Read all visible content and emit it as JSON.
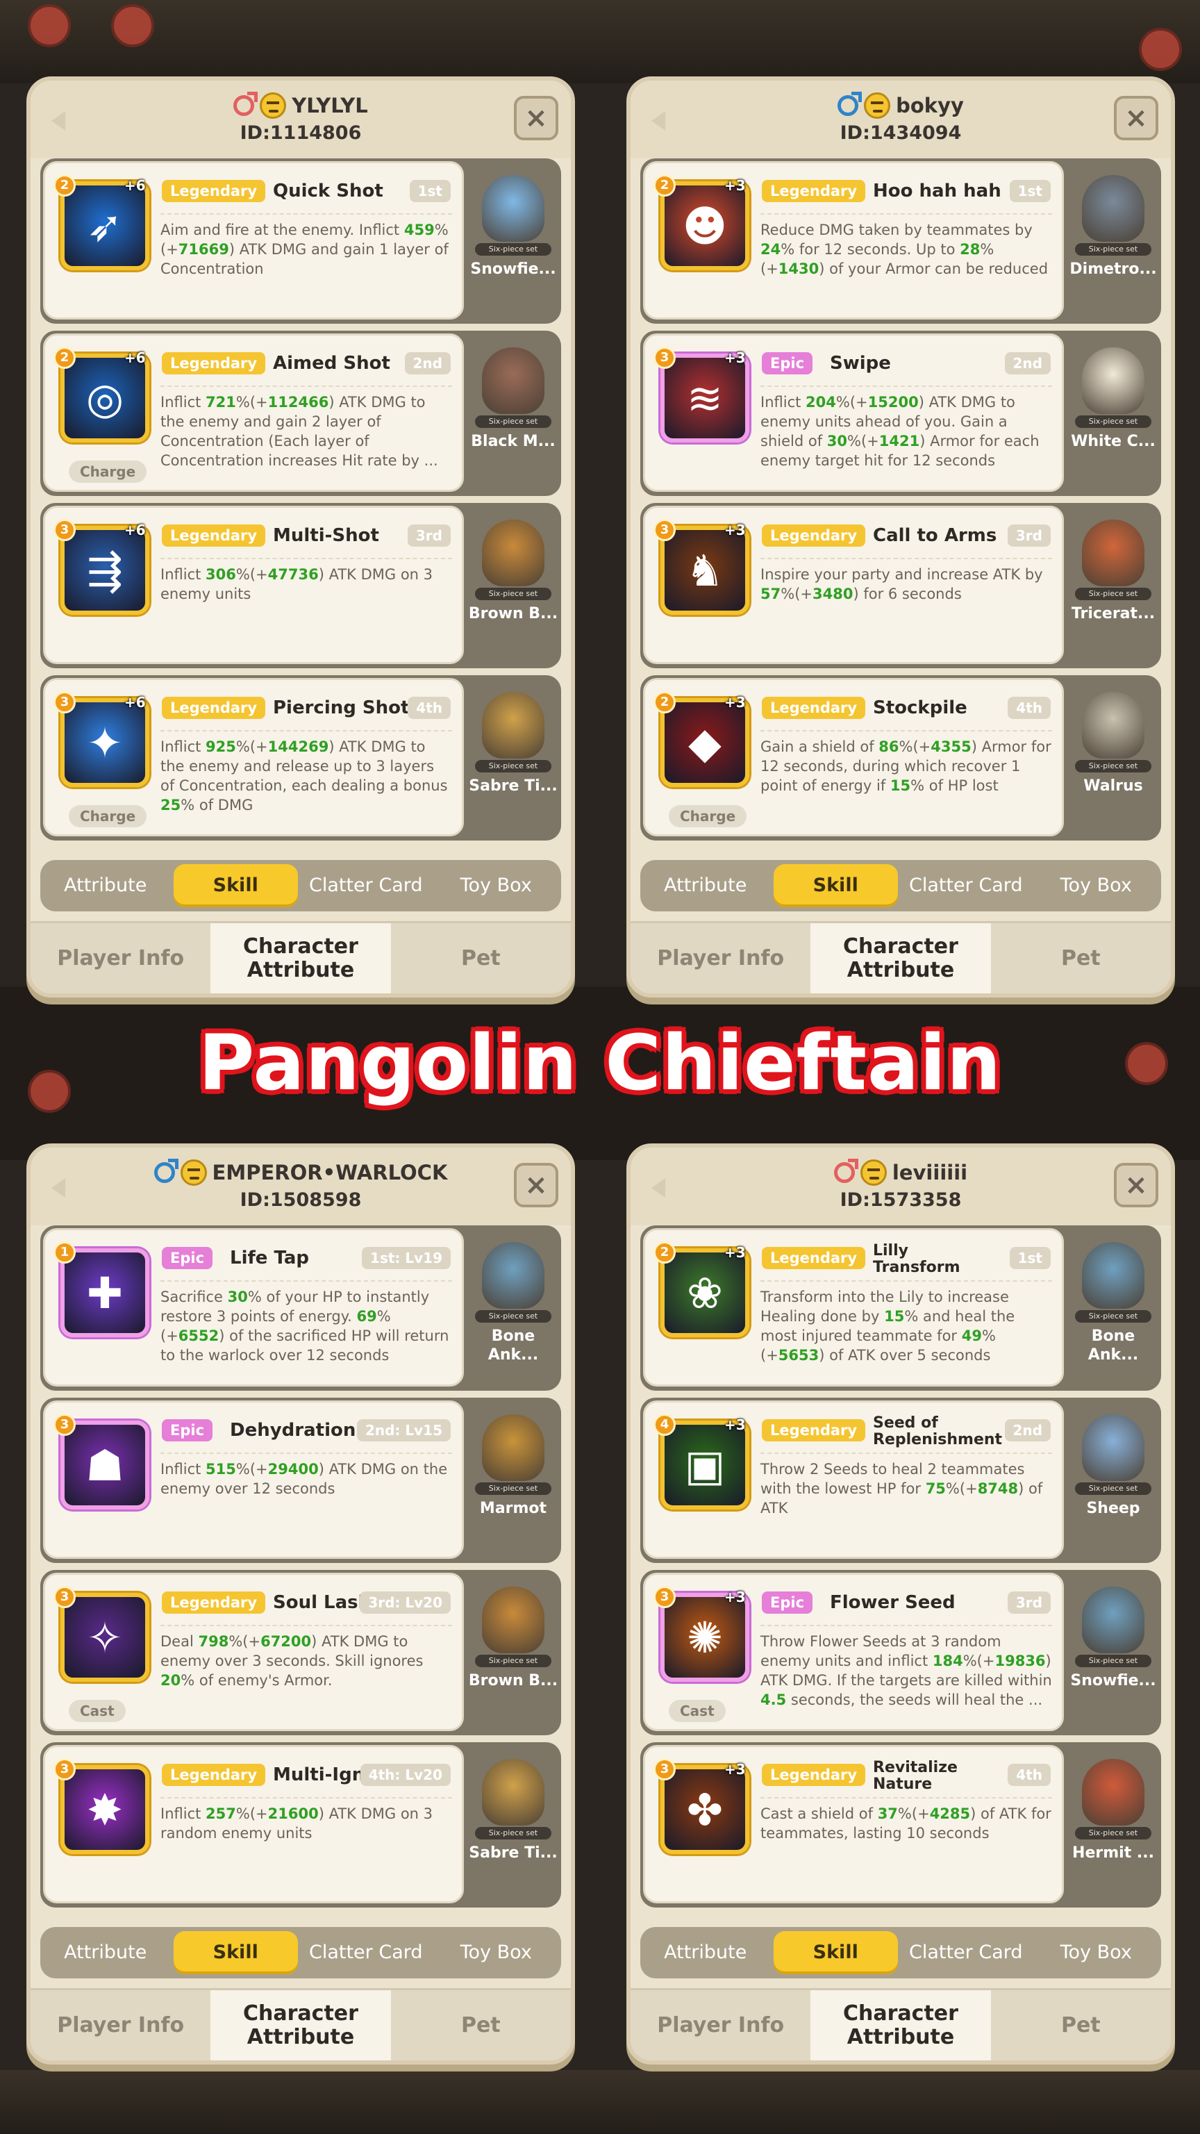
{
  "title": "Pangolin Chieftain",
  "panels": [
    {
      "gender": "female",
      "name": "YLYLYL",
      "id": "ID:1114806",
      "close_label": "×",
      "skills": [
        {
          "rarity": "Legendary",
          "name": "Quick Shot",
          "order": "1st",
          "stars": "2",
          "plus": "+6",
          "tag": "",
          "desc": "Aim and fire at the enemy. Inflict 459%(+71669) ATK DMG and gain 1 layer of Concentration",
          "pet": "Snowfie..."
        },
        {
          "rarity": "Legendary",
          "name": "Aimed Shot",
          "order": "2nd",
          "stars": "2",
          "plus": "+6",
          "tag": "Charge",
          "desc": "Inflict 721%(+112466) ATK DMG to the enemy and gain 2 layer of Concentration (Each layer of Concentration increases Hit rate by ...",
          "pet": "Black M..."
        },
        {
          "rarity": "Legendary",
          "name": "Multi-Shot",
          "order": "3rd",
          "stars": "3",
          "plus": "+6",
          "tag": "",
          "desc": "Inflict 306%(+47736) ATK DMG on 3 enemy units",
          "pet": "Brown B..."
        },
        {
          "rarity": "Legendary",
          "name": "Piercing Shot",
          "order": "4th",
          "stars": "3",
          "plus": "+6",
          "tag": "Charge",
          "desc": "Inflict 925%(+144269) ATK DMG to the enemy and release up to 3 layers of Concentration, each dealing a bonus 25% of DMG",
          "pet": "Sabre Ti..."
        }
      ]
    },
    {
      "gender": "male",
      "name": "bokyy",
      "id": "ID:1434094",
      "close_label": "×",
      "skills": [
        {
          "rarity": "Legendary",
          "name": "Hoo hah hah",
          "order": "1st",
          "stars": "2",
          "plus": "+3",
          "tag": "",
          "desc": "Reduce DMG taken by teammates by 24% for 12 seconds. Up to 28%(+1430) of your Armor can be reduced",
          "pet": "Dimetro..."
        },
        {
          "rarity": "Epic",
          "name": "Swipe",
          "order": "2nd",
          "stars": "3",
          "plus": "+3",
          "tag": "",
          "desc": "Inflict 204%(+15200) ATK DMG to enemy units ahead of you. Gain a shield of 30%(+1421) Armor for each enemy target hit for 12 seconds",
          "pet": "White C..."
        },
        {
          "rarity": "Legendary",
          "name": "Call to Arms",
          "order": "3rd",
          "stars": "3",
          "plus": "+3",
          "tag": "",
          "desc": "Inspire your party and increase ATK by 57%(+3480) for 6 seconds",
          "pet": "Tricerat..."
        },
        {
          "rarity": "Legendary",
          "name": "Stockpile",
          "order": "4th",
          "stars": "2",
          "plus": "+3",
          "tag": "Charge",
          "desc": "Gain a shield of 86%(+4355) Armor for 12 seconds, during which recover 1 point of energy if 15% of HP lost",
          "pet": "Walrus"
        }
      ]
    },
    {
      "gender": "male",
      "name": "EMPEROR•WARLOCK",
      "id": "ID:1508598",
      "close_label": "×",
      "skills": [
        {
          "rarity": "Epic",
          "name": "Life Tap",
          "order": "1st: Lv19",
          "stars": "1",
          "plus": "",
          "tag": "",
          "desc": "Sacrifice 30% of your HP to instantly restore 3 points of energy. 69%(+6552) of the sacrificed HP will return to the warlock over 12 seconds",
          "pet": "Bone Ank..."
        },
        {
          "rarity": "Epic",
          "name": "Dehydration",
          "order": "2nd: Lv15",
          "stars": "3",
          "plus": "",
          "tag": "",
          "desc": "Inflict 515%(+29400) ATK DMG on the enemy over 12 seconds",
          "pet": "Marmot"
        },
        {
          "rarity": "Legendary",
          "name": "Soul Lash",
          "order": "3rd: Lv20",
          "stars": "3",
          "plus": "",
          "tag": "Cast",
          "desc": "Deal 798%(+67200) ATK DMG to enemy over 3 seconds. Skill ignores 20% of enemy's Armor.",
          "pet": "Brown B..."
        },
        {
          "rarity": "Legendary",
          "name": "Multi-Ignition",
          "order": "4th: Lv20",
          "stars": "3",
          "plus": "",
          "tag": "",
          "desc": "Inflict 257%(+21600) ATK DMG on 3 random enemy units",
          "pet": "Sabre Ti..."
        }
      ]
    },
    {
      "gender": "female",
      "name": "leviiiiii",
      "id": "ID:1573358",
      "close_label": "×",
      "skills": [
        {
          "rarity": "Legendary",
          "name": "Lilly Transform",
          "order": "1st",
          "stars": "2",
          "plus": "+3",
          "tag": "",
          "desc": "Transform into the Lily to increase Healing done by 15% and heal the most injured teammate for 49%(+5653) of ATK over 5 seconds",
          "pet": "Bone Ank..."
        },
        {
          "rarity": "Legendary",
          "name": "Seed of Replenishment",
          "order": "2nd",
          "stars": "4",
          "plus": "+3",
          "tag": "",
          "desc": "Throw 2 Seeds to heal 2 teammates with the lowest HP for 75%(+8748) of ATK",
          "pet": "Sheep"
        },
        {
          "rarity": "Epic",
          "name": "Flower Seed",
          "order": "3rd",
          "stars": "3",
          "plus": "+3",
          "tag": "Cast",
          "desc": "Throw Flower Seeds at 3 random enemy units and inflict 184%(+19836) ATK DMG. If the targets are killed within 4.5 seconds, the seeds will heal the ...",
          "pet": "Snowfie..."
        },
        {
          "rarity": "Legendary",
          "name": "Revitalize Nature",
          "order": "4th",
          "stars": "3",
          "plus": "+3",
          "tag": "",
          "desc": "Cast a shield of 37%(+4285) of ATK for teammates, lasting 10 seconds",
          "pet": "Hermit ..."
        }
      ]
    }
  ],
  "pet_set_label": "Six-piece set",
  "sub_tabs": [
    "Attribute",
    "Skill",
    "Clatter Card",
    "Toy Box"
  ],
  "bottom_tabs": [
    "Player Info",
    "Character Attribute",
    "Pet"
  ],
  "colors": {
    "legendary": "#f5c431",
    "epic": "#e57fd8",
    "highlight_green": "#2fa023",
    "title_outline": "#e0141c",
    "active_tab": "#f7c92a"
  }
}
